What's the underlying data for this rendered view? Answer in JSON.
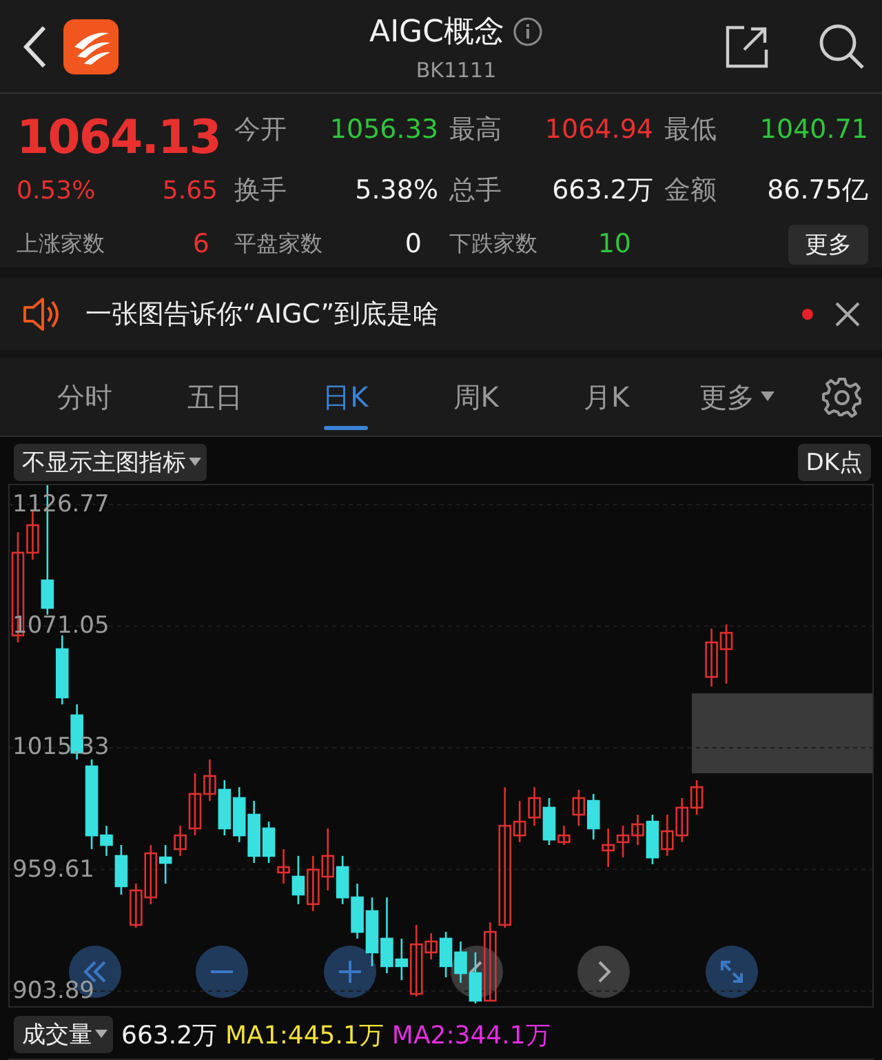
{
  "header": {
    "title": "AIGC概念",
    "code": "BK1111"
  },
  "quote": {
    "price": "1064.13",
    "change_pct": "0.53%",
    "change": "5.65",
    "color": "#e8312f",
    "stats": [
      {
        "label": "今开",
        "value": "1056.33",
        "color": "#2fc53c"
      },
      {
        "label": "最高",
        "value": "1064.94",
        "color": "#e8312f"
      },
      {
        "label": "最低",
        "value": "1040.71",
        "color": "#2fc53c"
      },
      {
        "label": "换手",
        "value": "5.38%",
        "color": "#f2f2f2"
      },
      {
        "label": "总手",
        "value": "663.2万",
        "color": "#f2f2f2"
      },
      {
        "label": "金额",
        "value": "86.75亿",
        "color": "#f2f2f2"
      }
    ],
    "breadth": [
      {
        "label": "上涨家数",
        "value": "6",
        "color": "#e8312f"
      },
      {
        "label": "平盘家数",
        "value": "0",
        "color": "#f2f2f2"
      },
      {
        "label": "下跌家数",
        "value": "10",
        "color": "#2fc53c"
      }
    ],
    "more_button": "更多"
  },
  "news": {
    "text": "一张图告诉你“AIGC”到底是啥",
    "unread": true
  },
  "tabs": [
    {
      "label": "分时",
      "selected": false,
      "kind": "tab"
    },
    {
      "label": "五日",
      "selected": false,
      "kind": "tab"
    },
    {
      "label": "日K",
      "selected": true,
      "kind": "tab"
    },
    {
      "label": "周K",
      "selected": false,
      "kind": "tab"
    },
    {
      "label": "月K",
      "selected": false,
      "kind": "tab"
    },
    {
      "label": "更多",
      "selected": false,
      "kind": "menu"
    }
  ],
  "chart": {
    "indicator": "不显示主图指标",
    "dk_button": "DK点",
    "chart_data": {
      "type": "candlestick",
      "grid": true,
      "ylim": [
        903.89,
        1126.77
      ],
      "yticks": [
        1126.77,
        1071.05,
        1015.33,
        959.61,
        903.89
      ],
      "ohlc": [
        [
          1066.8,
          1114.1,
          1063.6,
          1104.7
        ],
        [
          1104.7,
          1123.6,
          1101.5,
          1117.3
        ],
        [
          1092.0,
          1136.2,
          1076.3,
          1079.4
        ],
        [
          1060.5,
          1066.8,
          1035.2,
          1038.4
        ],
        [
          1030.2,
          1035.2,
          1010.0,
          1013.1
        ],
        [
          1006.8,
          1010.0,
          968.9,
          975.2
        ],
        [
          975.2,
          979.6,
          965.8,
          970.8
        ],
        [
          965.8,
          970.8,
          948.1,
          951.9
        ],
        [
          934.2,
          953.1,
          932.9,
          950.0
        ],
        [
          946.8,
          970.8,
          943.7,
          967.0
        ],
        [
          965.1,
          970.8,
          953.1,
          962.6
        ],
        [
          968.9,
          979.6,
          965.8,
          975.2
        ],
        [
          978.4,
          1003.7,
          975.2,
          994.2
        ],
        [
          994.2,
          1010.0,
          991.0,
          1002.4
        ],
        [
          996.1,
          1000.5,
          975.2,
          978.4
        ],
        [
          992.3,
          997.3,
          972.1,
          975.2
        ],
        [
          984.7,
          991.0,
          962.6,
          965.8
        ],
        [
          978.4,
          981.5,
          962.6,
          965.8
        ],
        [
          958.2,
          968.9,
          953.1,
          960.7
        ],
        [
          956.3,
          965.8,
          943.7,
          948.1
        ],
        [
          943.7,
          965.8,
          940.5,
          959.5
        ],
        [
          956.3,
          978.4,
          950.0,
          965.8
        ],
        [
          960.7,
          965.8,
          943.7,
          946.8
        ],
        [
          946.8,
          953.1,
          927.9,
          931.0
        ],
        [
          940.5,
          946.8,
          915.3,
          921.6
        ],
        [
          927.9,
          946.8,
          912.1,
          915.3
        ],
        [
          918.4,
          927.9,
          908.9,
          915.3
        ],
        [
          902.6,
          934.2,
          901.4,
          925.3
        ],
        [
          921.6,
          930.4,
          918.4,
          926.6
        ],
        [
          927.9,
          931.0,
          910.2,
          915.3
        ],
        [
          921.6,
          926.6,
          907.7,
          912.1
        ],
        [
          912.1,
          921.6,
          898.2,
          899.5
        ],
        [
          899.5,
          935.4,
          899.5,
          931.0
        ],
        [
          934.2,
          997.3,
          932.9,
          979.6
        ],
        [
          975.2,
          991.0,
          972.1,
          981.5
        ],
        [
          983.4,
          997.3,
          979.6,
          992.3
        ],
        [
          987.9,
          992.3,
          970.8,
          973.3
        ],
        [
          972.1,
          979.6,
          970.8,
          975.2
        ],
        [
          984.7,
          996.1,
          979.6,
          992.3
        ],
        [
          991.0,
          994.2,
          973.3,
          978.4
        ],
        [
          968.3,
          978.4,
          960.7,
          970.8
        ],
        [
          972.1,
          979.6,
          965.1,
          975.2
        ],
        [
          975.2,
          984.7,
          970.8,
          980.3
        ],
        [
          981.5,
          984.7,
          962.0,
          965.1
        ],
        [
          968.9,
          984.7,
          965.8,
          977.1
        ],
        [
          975.2,
          992.3,
          972.1,
          987.9
        ],
        [
          987.9,
          1000.5,
          984.7,
          997.3
        ],
        [
          1047.8,
          1069.9,
          1043.4,
          1063.6
        ],
        [
          1060.5,
          1071.8,
          1044.7,
          1068.0
        ]
      ]
    }
  },
  "volume": {
    "label": "成交量",
    "value": "663.2万",
    "ma1": "MA1:445.1万",
    "ma2": "MA2:344.1万"
  }
}
